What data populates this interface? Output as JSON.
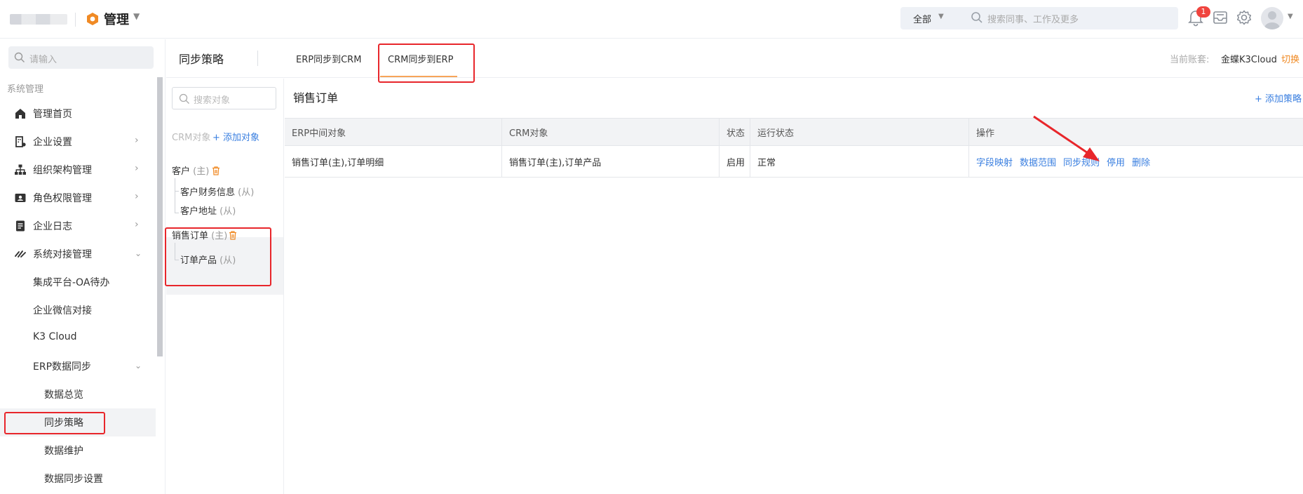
{
  "topbar": {
    "app_title": "管理",
    "scope": "全部",
    "search_placeholder": "搜索同事、工作及更多",
    "notification_count": "1"
  },
  "sidebar": {
    "search_placeholder": "请输入",
    "section": "系统管理",
    "items": [
      {
        "label": "管理首页",
        "icon": "home-icon",
        "chevron": ""
      },
      {
        "label": "企业设置",
        "icon": "building-icon",
        "chevron": ">"
      },
      {
        "label": "组织架构管理",
        "icon": "org-chart-icon",
        "chevron": ">"
      },
      {
        "label": "角色权限管理",
        "icon": "id-card-icon",
        "chevron": ">"
      },
      {
        "label": "企业日志",
        "icon": "document-icon",
        "chevron": ">"
      },
      {
        "label": "系统对接管理",
        "icon": "link-icon",
        "chevron": "v"
      }
    ],
    "sub_items": [
      {
        "label": "集成平台-OA待办"
      },
      {
        "label": "企业微信对接"
      },
      {
        "label": "K3 Cloud"
      },
      {
        "label": "ERP数据同步",
        "chevron": "v"
      }
    ],
    "sub_sub_items": [
      {
        "label": "数据总览"
      },
      {
        "label": "同步策略"
      },
      {
        "label": "数据维护"
      },
      {
        "label": "数据同步设置"
      }
    ]
  },
  "header": {
    "title": "同步策略",
    "tabs": [
      {
        "label": "ERP同步到CRM"
      },
      {
        "label": "CRM同步到ERP"
      }
    ],
    "account_label": "当前账套:",
    "account_value": "金蝶K3Cloud",
    "switch_label": "切换"
  },
  "object_panel": {
    "search_placeholder": "搜索对象",
    "crm_label": "CRM对象",
    "add_label": "+ 添加对象",
    "groups": [
      {
        "main": "客户",
        "main_tag": "(主)",
        "children": [
          {
            "label": "客户财务信息",
            "tag": "(从)"
          },
          {
            "label": "客户地址",
            "tag": "(从)"
          }
        ]
      },
      {
        "main": "销售订单",
        "main_tag": "(主)",
        "children": [
          {
            "label": "订单产品",
            "tag": "(从)"
          }
        ]
      }
    ]
  },
  "main": {
    "title": "销售订单",
    "add_strategy": "+ 添加策略",
    "columns": [
      "ERP中间对象",
      "CRM对象",
      "状态",
      "运行状态",
      "操作"
    ],
    "rows": [
      {
        "erp": "销售订单(主),订单明细",
        "crm": "销售订单(主),订单产品",
        "status": "启用",
        "run_status": "正常",
        "actions": [
          "字段映射",
          "数据范围",
          "同步规则",
          "停用",
          "删除"
        ]
      }
    ]
  },
  "colors": {
    "accent_blue": "#3a7fe0",
    "accent_orange": "#f08a24",
    "annotation_red": "#e8262b",
    "badge_red": "#f0443e"
  }
}
